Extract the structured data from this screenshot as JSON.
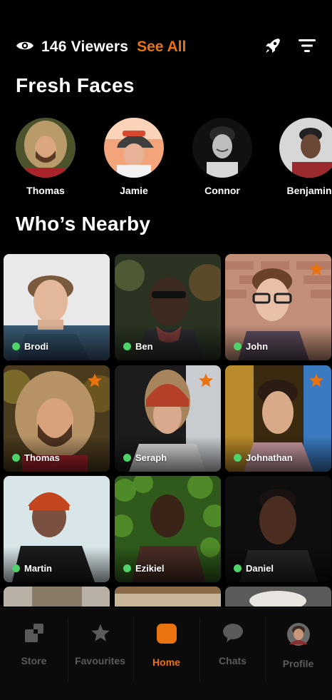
{
  "header": {
    "viewers_icon": "eye-icon",
    "viewers_label": "146 Viewers",
    "see_all_label": "See All",
    "boost_icon": "rocket-icon",
    "filter_icon": "filter-icon"
  },
  "fresh_faces": {
    "title": "Fresh Faces",
    "people": [
      {
        "name": "Thomas"
      },
      {
        "name": "Jamie"
      },
      {
        "name": "Connor"
      },
      {
        "name": "Benjamin"
      }
    ]
  },
  "nearby": {
    "title": "Who’s Nearby",
    "people": [
      {
        "name": "Brodi",
        "online": true,
        "favourite": false,
        "selected": true
      },
      {
        "name": "Ben",
        "online": true,
        "favourite": false,
        "selected": false
      },
      {
        "name": "John",
        "online": true,
        "favourite": true,
        "selected": false
      },
      {
        "name": "Thomas",
        "online": true,
        "favourite": true,
        "selected": false
      },
      {
        "name": "Seraph",
        "online": true,
        "favourite": true,
        "selected": false
      },
      {
        "name": "Johnathan",
        "online": true,
        "favourite": true,
        "selected": false
      },
      {
        "name": "Martin",
        "online": true,
        "favourite": false,
        "selected": false
      },
      {
        "name": "Ezikiel",
        "online": true,
        "favourite": false,
        "selected": false
      },
      {
        "name": "Daniel",
        "online": true,
        "favourite": false,
        "selected": false
      }
    ]
  },
  "tabs": [
    {
      "label": "Store",
      "icon": "store-icon",
      "active": false
    },
    {
      "label": "Favourites",
      "icon": "star-icon",
      "active": false
    },
    {
      "label": "Home",
      "icon": "home-icon",
      "active": true
    },
    {
      "label": "Chats",
      "icon": "chat-bubble-icon",
      "active": false
    },
    {
      "label": "Profile",
      "icon": "avatar",
      "active": false
    }
  ],
  "colors": {
    "accent": "#e8730f",
    "online": "#4ed36b",
    "background": "#000000",
    "tab_inactive": "#5a5a5a"
  }
}
